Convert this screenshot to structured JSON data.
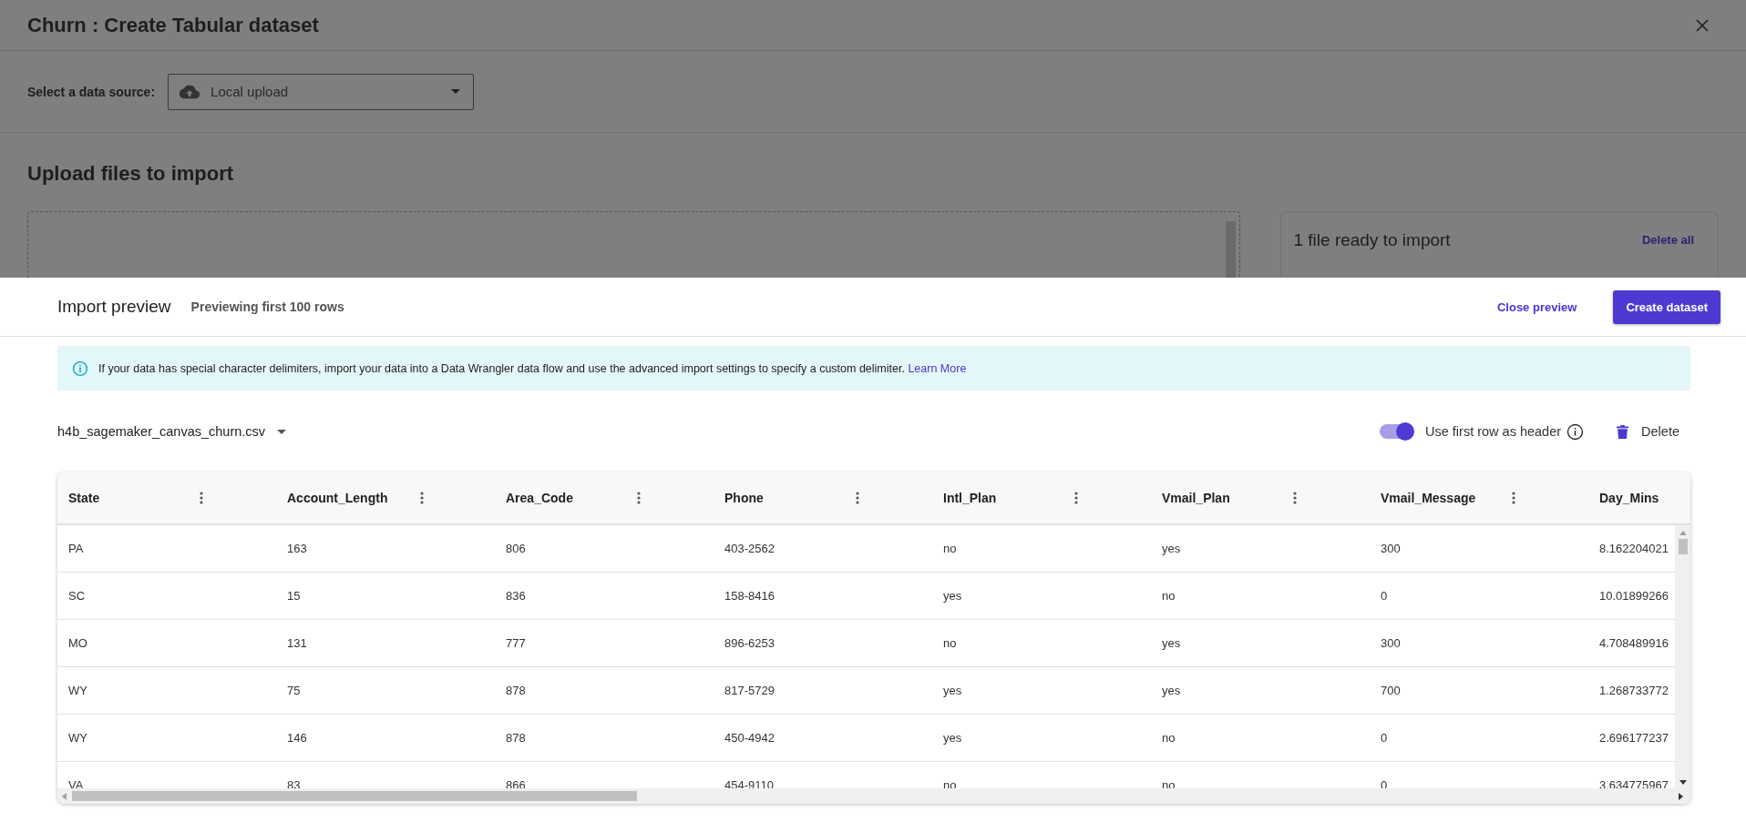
{
  "dialog": {
    "title": "Churn : Create Tabular dataset",
    "source_label": "Select a data source:",
    "source_value": "Local upload",
    "upload_heading": "Upload files to import",
    "ready_card": {
      "title": "1 file ready to import",
      "action": "Delete all"
    }
  },
  "preview": {
    "title": "Import preview",
    "subtitle": "Previewing first 100 rows",
    "close": "Close preview",
    "create": "Create dataset",
    "notice": {
      "text": "If your data has special character delimiters, import your data into a Data Wrangler data flow and use the advanced import settings to specify a custom delimiter.",
      "link": "Learn More"
    },
    "file": "h4b_sagemaker_canvas_churn.csv",
    "header_toggle": {
      "label": "Use first row as header",
      "on": true
    },
    "delete": "Delete",
    "table": {
      "columns": [
        {
          "label": "State",
          "menu": true
        },
        {
          "label": "Account_Length",
          "menu": true
        },
        {
          "label": "Area_Code",
          "menu": true
        },
        {
          "label": "Phone",
          "menu": true
        },
        {
          "label": "Intl_Plan",
          "menu": true
        },
        {
          "label": "Vmail_Plan",
          "menu": true
        },
        {
          "label": "Vmail_Message",
          "menu": true
        },
        {
          "label": "Day_Mins",
          "menu": false
        }
      ],
      "rows": [
        [
          "PA",
          "163",
          "806",
          "403-2562",
          "no",
          "yes",
          "300",
          "8.162204021"
        ],
        [
          "SC",
          "15",
          "836",
          "158-8416",
          "yes",
          "no",
          "0",
          "10.01899266"
        ],
        [
          "MO",
          "131",
          "777",
          "896-6253",
          "no",
          "yes",
          "300",
          "4.708489916"
        ],
        [
          "WY",
          "75",
          "878",
          "817-5729",
          "yes",
          "yes",
          "700",
          "1.268733772"
        ],
        [
          "WY",
          "146",
          "878",
          "450-4942",
          "yes",
          "no",
          "0",
          "2.696177237"
        ],
        [
          "VA",
          "83",
          "866",
          "454-9110",
          "no",
          "no",
          "0",
          "3.634775967"
        ]
      ]
    }
  }
}
